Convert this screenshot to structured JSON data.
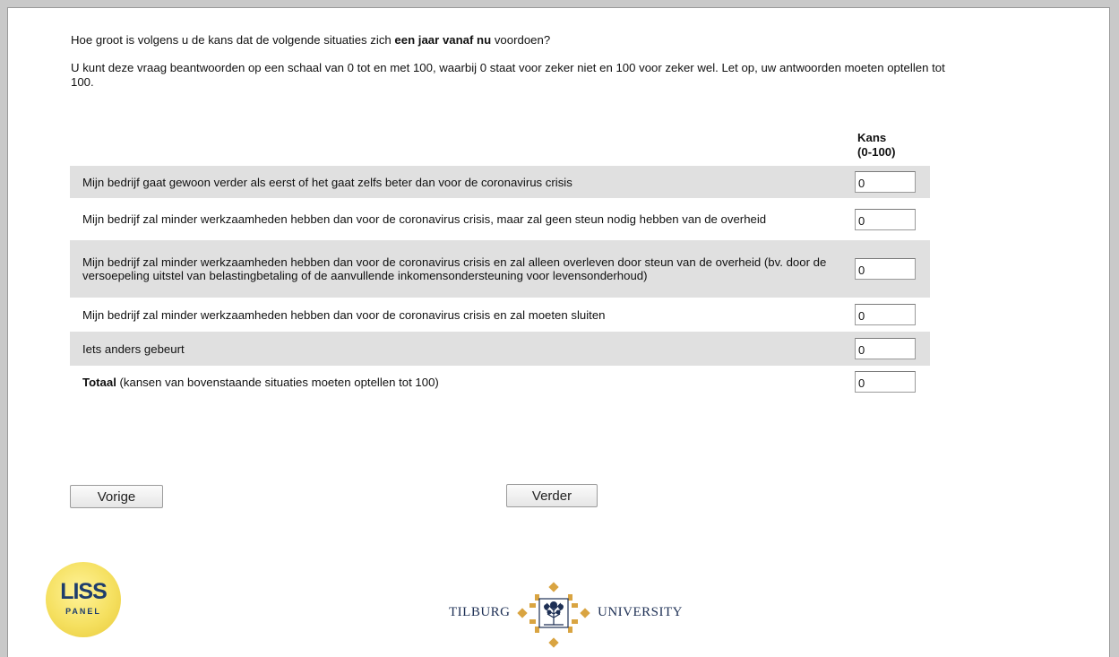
{
  "intro": {
    "q_before": "Hoe groot is volgens u de kans dat de volgende situaties zich ",
    "q_bold": "een jaar vanaf nu",
    "q_after": " voordoen?",
    "scale_text": "U kunt deze vraag beantwoorden op een schaal van 0 tot en met 100, waarbij 0 staat voor zeker niet en 100 voor zeker wel. Let op, uw antwoorden moeten optellen tot 100."
  },
  "table": {
    "header_line1": "Kans",
    "header_line2": "(0-100)",
    "rows": [
      {
        "label": "Mijn bedrijf gaat gewoon verder als eerst of het gaat zelfs beter dan voor de coronavirus crisis",
        "value": "0"
      },
      {
        "label": "Mijn bedrijf zal minder werkzaamheden hebben dan voor de coronavirus crisis, maar zal geen steun nodig hebben van de overheid",
        "value": "0"
      },
      {
        "label": "Mijn bedrijf zal minder werkzaamheden hebben dan voor de coronavirus crisis en zal alleen overleven door steun van de overheid (bv. door de versoepeling uitstel van belastingbetaling of de aanvullende inkomensondersteuning voor levensonderhoud)",
        "value": "0"
      },
      {
        "label": "Mijn bedrijf zal minder werkzaamheden hebben dan voor de coronavirus crisis en zal moeten sluiten",
        "value": "0"
      },
      {
        "label": "Iets anders gebeurt",
        "value": "0"
      }
    ],
    "total_bold": "Totaal",
    "total_rest": " (kansen van bovenstaande situaties moeten optellen tot 100)",
    "total_value": "0"
  },
  "buttons": {
    "prev": "Vorige",
    "next": "Verder"
  },
  "logos": {
    "liss_line1": "LISS",
    "liss_line2": "PANEL",
    "tilburg_left": "TILBURG",
    "tilburg_right": "UNIVERSITY"
  },
  "colors": {
    "row_shade": "#e0e0e0",
    "tilburg_gold": "#d9a441",
    "tilburg_navy": "#1d2f54",
    "liss_yellow": "#f5e060"
  }
}
